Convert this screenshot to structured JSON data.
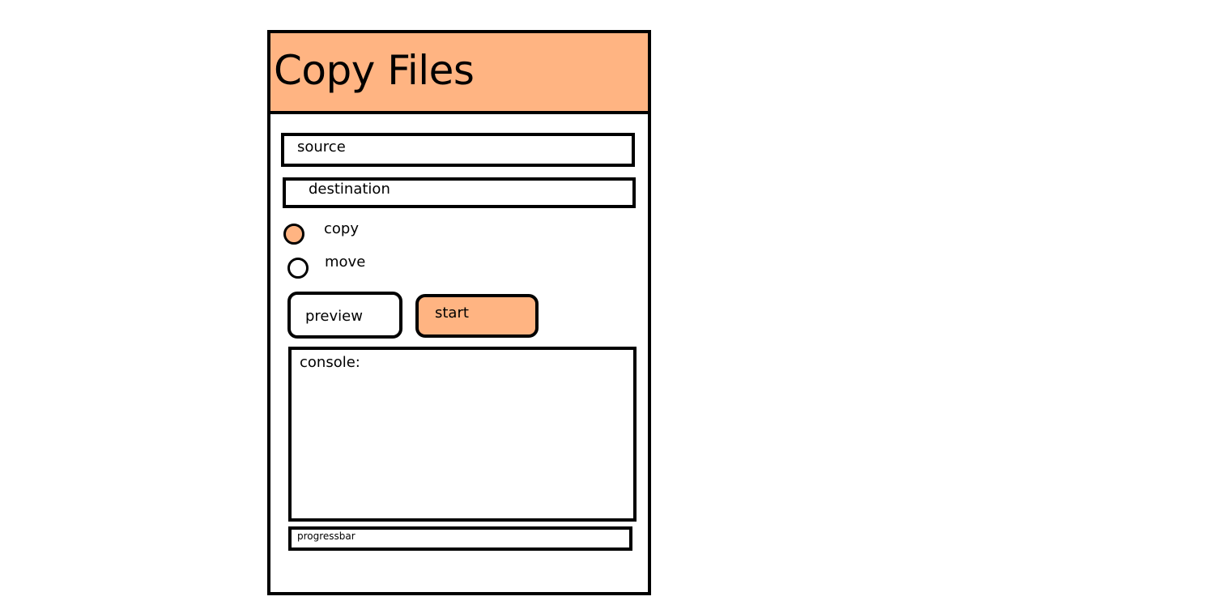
{
  "window": {
    "title": "Copy Files",
    "accent_color": "#FFB482"
  },
  "form": {
    "source_placeholder": "source",
    "destination_placeholder": "destination"
  },
  "mode": {
    "options": [
      {
        "label": "copy",
        "selected": true
      },
      {
        "label": "move",
        "selected": false
      }
    ]
  },
  "actions": {
    "preview_label": "preview",
    "start_label": "start"
  },
  "console": {
    "label": "console:"
  },
  "progress": {
    "label": "progressbar"
  }
}
